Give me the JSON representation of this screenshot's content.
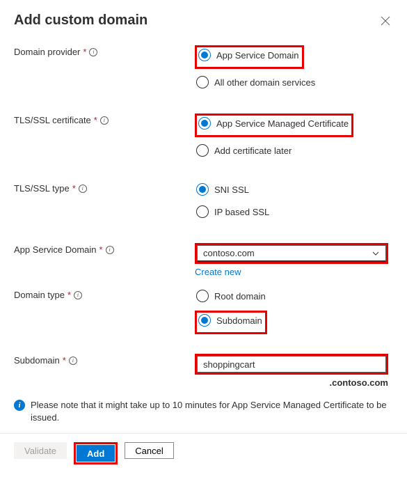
{
  "title": "Add custom domain",
  "fields": {
    "domainProvider": {
      "label": "Domain provider",
      "options": [
        "App Service Domain",
        "All other domain services"
      ],
      "selected": "App Service Domain"
    },
    "tlsCert": {
      "label": "TLS/SSL certificate",
      "options": [
        "App Service Managed Certificate",
        "Add certificate later"
      ],
      "selected": "App Service Managed Certificate"
    },
    "tlsType": {
      "label": "TLS/SSL type",
      "options": [
        "SNI SSL",
        "IP based SSL"
      ],
      "selected": "SNI SSL"
    },
    "appServiceDomain": {
      "label": "App Service Domain",
      "value": "contoso.com",
      "createNew": "Create new"
    },
    "domainType": {
      "label": "Domain type",
      "options": [
        "Root domain",
        "Subdomain"
      ],
      "selected": "Subdomain"
    },
    "subdomain": {
      "label": "Subdomain",
      "value": "shoppingcart",
      "suffix": ".contoso.com"
    }
  },
  "note": "Please note that it might take up to 10 minutes for App Service Managed Certificate to be issued.",
  "buttons": {
    "validate": "Validate",
    "add": "Add",
    "cancel": "Cancel"
  }
}
